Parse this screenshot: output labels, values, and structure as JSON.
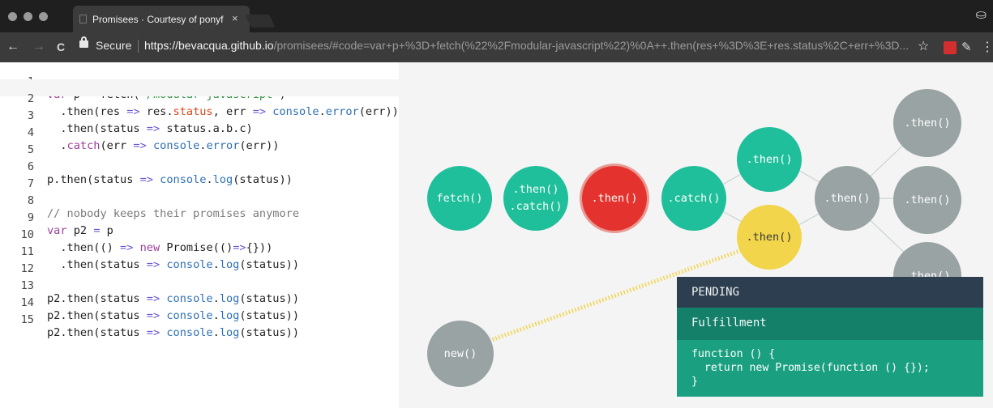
{
  "browser": {
    "tab_title": "Promisees · Courtesy of ponyf",
    "tab_close": "×",
    "secure_label": "Secure",
    "url_host": "https://bevacqua.github.io",
    "url_path": "/promisees/#code=var+p+%3D+fetch(%22%2Fmodular-javascript%22)%0A++.then(res+%3D%3E+res.status%2C+err+%3D...",
    "back_icon": "←",
    "forward_icon": "→",
    "reload_icon": "C",
    "star_icon": "☆",
    "menu_icon": "⋮",
    "incognito_icon": "⛀"
  },
  "editor": {
    "line_numbers": [
      "1",
      "2",
      "3",
      "4",
      "5",
      "6",
      "7",
      "8",
      "9",
      "10",
      "11",
      "12",
      "13",
      "14",
      "15"
    ]
  },
  "viz": {
    "nodes": {
      "fetch": "fetch()",
      "then_catch_top": ".then()",
      "then_catch_bottom": ".catch()",
      "red_then": ".then()",
      "catch": ".catch()",
      "upper_then": ".then()",
      "yellow_then": ".then()",
      "gray_then_mid": ".then()",
      "gray_then_top": ".then()",
      "gray_then_right": ".then()",
      "gray_then_partial": ".then()",
      "new": "new()"
    },
    "colors": {
      "fulfilled": "#1fbf9b",
      "rejected": "#e4332e",
      "pending": "#f2d54b",
      "inactive": "#99a3a3"
    }
  },
  "tooltip": {
    "state": "PENDING",
    "kind": "Fulfillment",
    "code_line1": "function () {",
    "code_line2": "  return new Promise(function () {});",
    "code_line3": "}"
  }
}
